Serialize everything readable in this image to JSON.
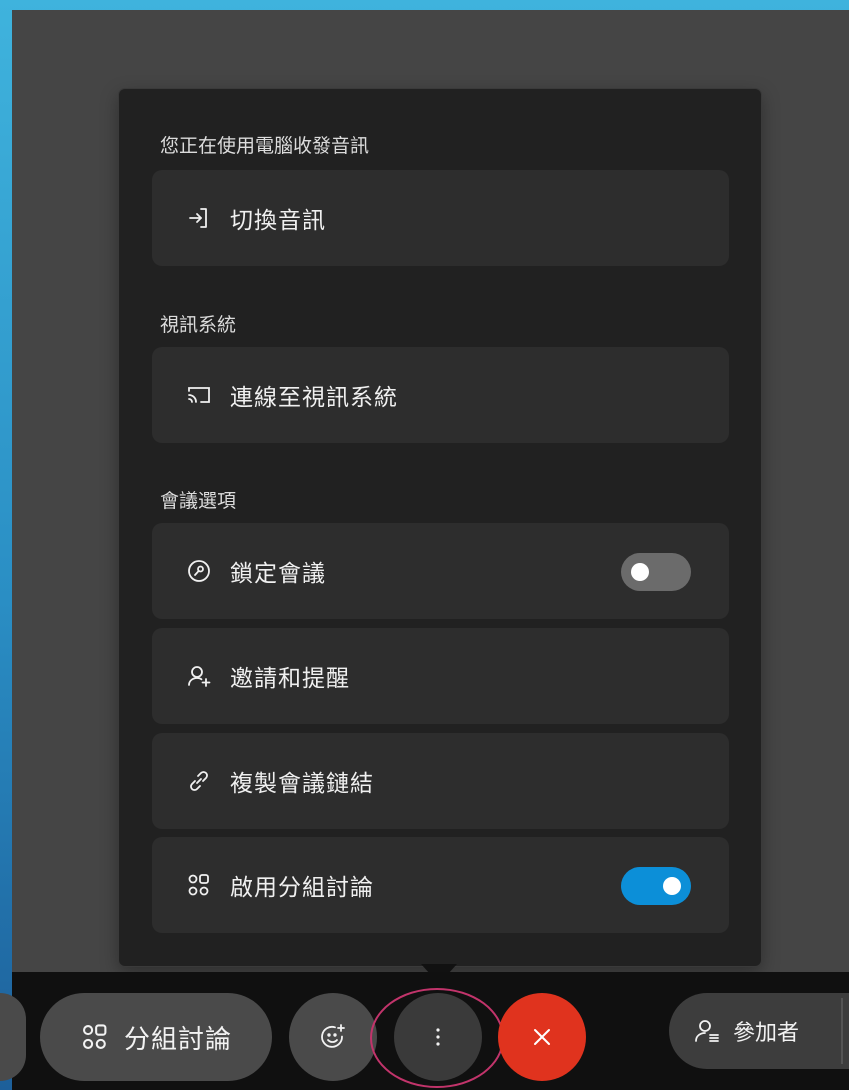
{
  "menu": {
    "audio_section_title": "您正在使用電腦收發音訊",
    "switch_audio_label": "切換音訊",
    "video_section_title": "視訊系統",
    "connect_video_label": "連線至視訊系統",
    "meeting_section_title": "會議選項",
    "lock_meeting_label": "鎖定會議",
    "lock_meeting_toggle": "off",
    "invite_label": "邀請和提醒",
    "copy_link_label": "複製會議鏈結",
    "breakout_enable_label": "啟用分組討論",
    "breakout_enable_toggle": "on"
  },
  "toolbar": {
    "breakout_label": "分組討論",
    "participants_label": "參加者",
    "more_icon": "more-vertical-icon",
    "reactions_icon": "emoji-add-icon",
    "leave_icon": "close-icon"
  },
  "colors": {
    "accent_toggle_on": "#0c8fd8",
    "leave_button": "#e0331e",
    "highlight_ring": "#c2346b"
  }
}
